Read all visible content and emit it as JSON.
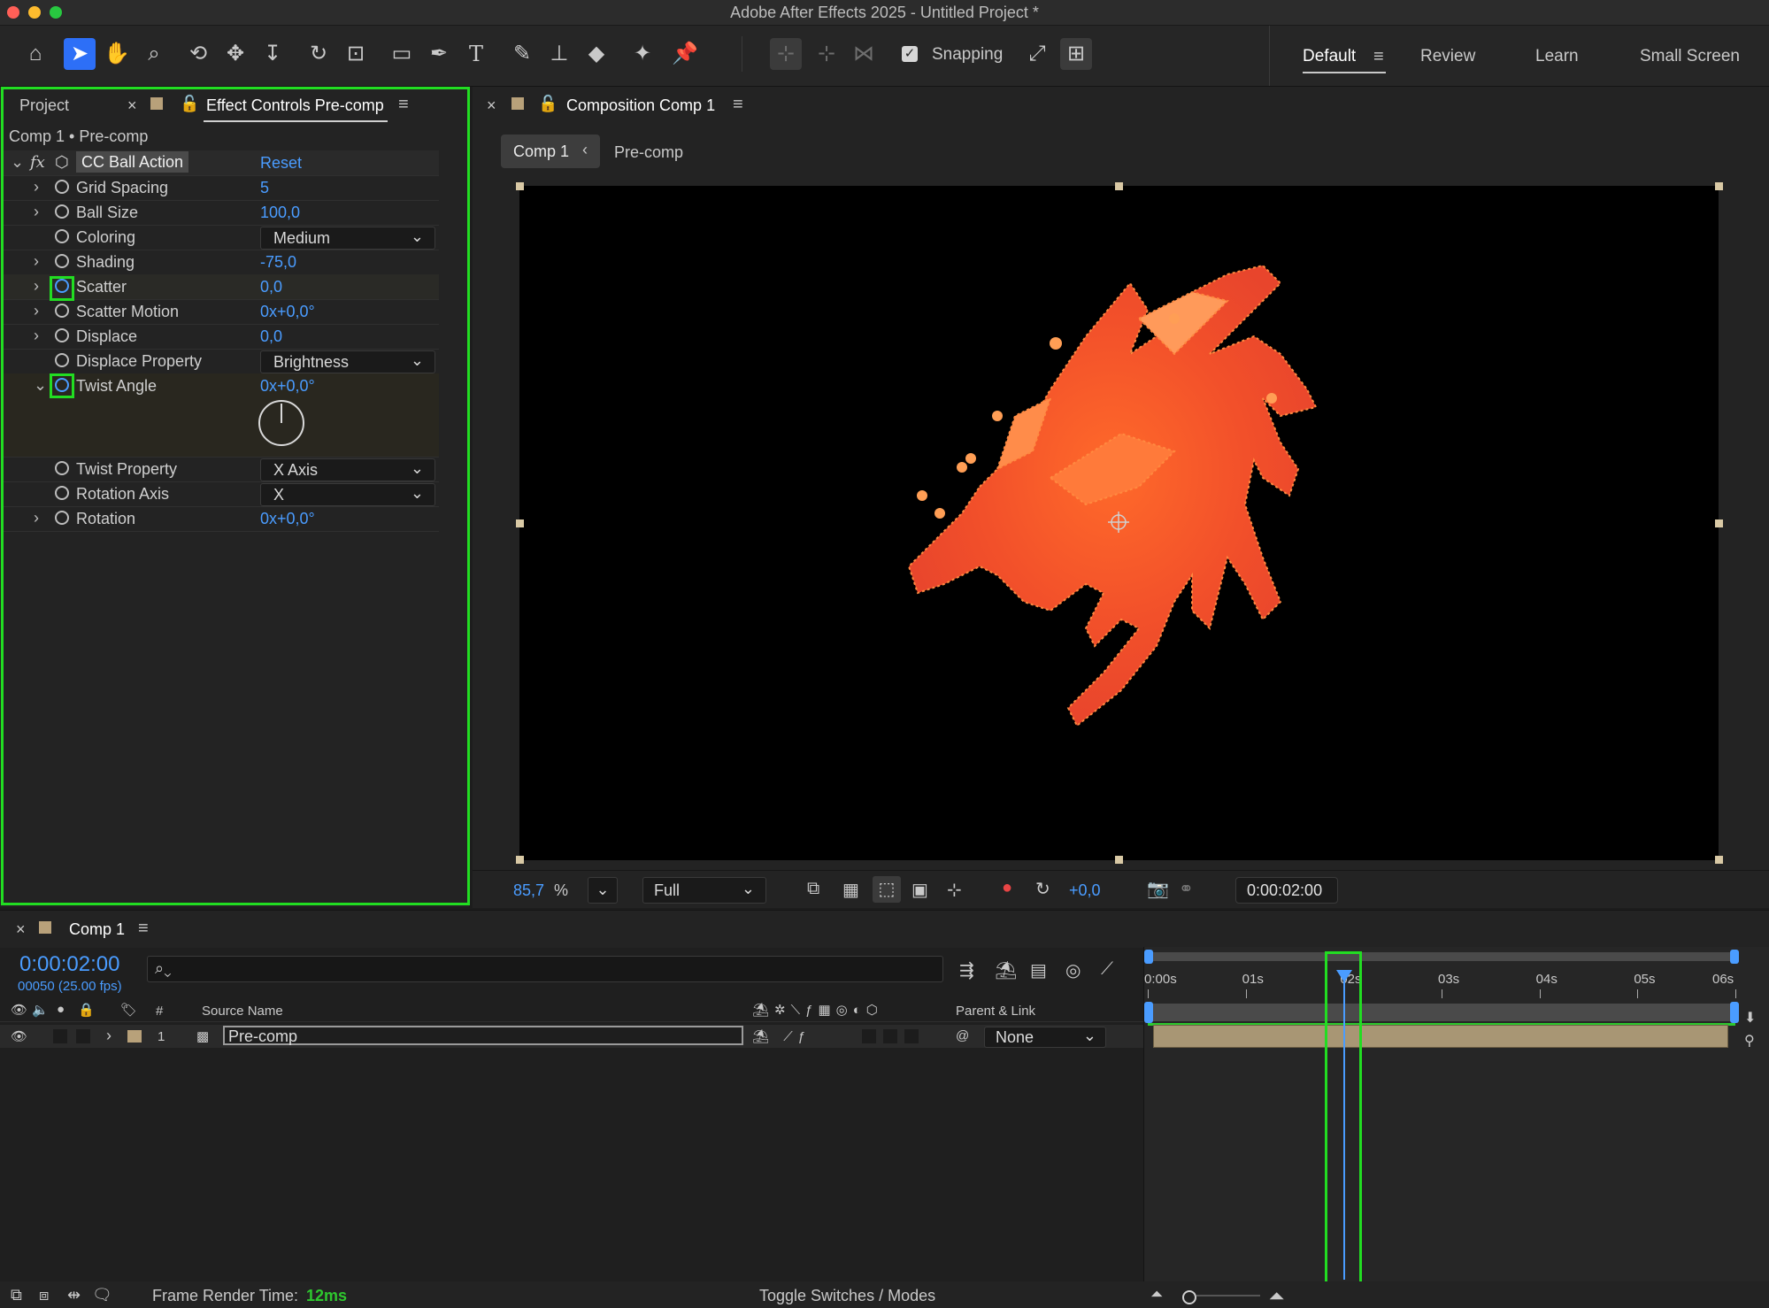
{
  "window": {
    "title": "Adobe After Effects 2025 - Untitled Project *"
  },
  "toolbar": {
    "tools": [
      "home-icon",
      "selection-icon",
      "hand-icon",
      "zoom-icon",
      "orbit-camera-icon",
      "pan-camera-icon",
      "dolly-camera-icon",
      "rotate-icon",
      "pan-behind-icon",
      "rectangle-icon",
      "pen-icon",
      "type-icon",
      "brush-icon",
      "clone-stamp-icon",
      "eraser-icon",
      "roto-brush-icon",
      "puppet-pin-icon"
    ],
    "snapping_label": "Snapping",
    "snapping_checked": true
  },
  "workspaces": {
    "items": [
      "Default",
      "Review",
      "Learn",
      "Small Screen"
    ],
    "active": "Default"
  },
  "effect_controls": {
    "tab_project": "Project",
    "tab_effect": "Effect Controls Pre-comp",
    "breadcrumb": "Comp 1 • Pre-comp",
    "effect_name": "CC Ball Action",
    "reset_label": "Reset",
    "fx_label": "fx",
    "properties": [
      {
        "label": "Grid Spacing",
        "value": "5",
        "kind": "value",
        "expandable": true
      },
      {
        "label": "Ball Size",
        "value": "100,0",
        "kind": "value",
        "expandable": true
      },
      {
        "label": "Coloring",
        "value": "Medium",
        "kind": "dropdown",
        "expandable": false
      },
      {
        "label": "Shading",
        "value": "-75,0",
        "kind": "value",
        "expandable": true
      },
      {
        "label": "Scatter",
        "value": "0,0",
        "kind": "value",
        "expandable": true
      },
      {
        "label": "Scatter Motion",
        "value": "0x+0,0°",
        "kind": "value",
        "expandable": true
      },
      {
        "label": "Displace",
        "value": "0,0",
        "kind": "value",
        "expandable": true
      },
      {
        "label": "Displace Property",
        "value": "Brightness",
        "kind": "dropdown",
        "expandable": false
      },
      {
        "label": "Twist Angle",
        "value": "0x+0,0°",
        "kind": "value",
        "expandable": true
      },
      {
        "label": "Twist Property",
        "value": "X Axis",
        "kind": "dropdown",
        "expandable": false
      },
      {
        "label": "Rotation Axis",
        "value": "X",
        "kind": "dropdown",
        "expandable": false
      },
      {
        "label": "Rotation",
        "value": "0x+0,0°",
        "kind": "value",
        "expandable": true
      }
    ]
  },
  "composition": {
    "tab": "Composition Comp 1",
    "crumb_active": "Comp 1",
    "crumb_next": "Pre-comp",
    "zoom": "85,7",
    "zoom_unit": "%",
    "resolution": "Full",
    "exposure": "+0,0",
    "timecode": "0:00:02:00"
  },
  "timeline": {
    "tab": "Comp 1",
    "current_time": "0:00:02:00",
    "frame_info": "00050 (25.00 fps)",
    "search_placeholder": "",
    "col_hash": "#",
    "col_source": "Source Name",
    "col_parent": "Parent & Link",
    "ruler": [
      "0:00s",
      "01s",
      "02s",
      "03s",
      "04s",
      "05s",
      "06s"
    ],
    "playhead_seconds": 2,
    "duration_seconds": 6,
    "layer": {
      "index": "1",
      "name": "Pre-comp",
      "parent": "None"
    }
  },
  "status": {
    "render_label": "Frame Render Time:",
    "render_value": "12ms",
    "toggle_label": "Toggle Switches / Modes"
  },
  "colors": {
    "accent": "#2d6ff7",
    "value_blue": "#4a9cff",
    "highlight": "#22dd22",
    "layer_bar": "#a89674"
  }
}
